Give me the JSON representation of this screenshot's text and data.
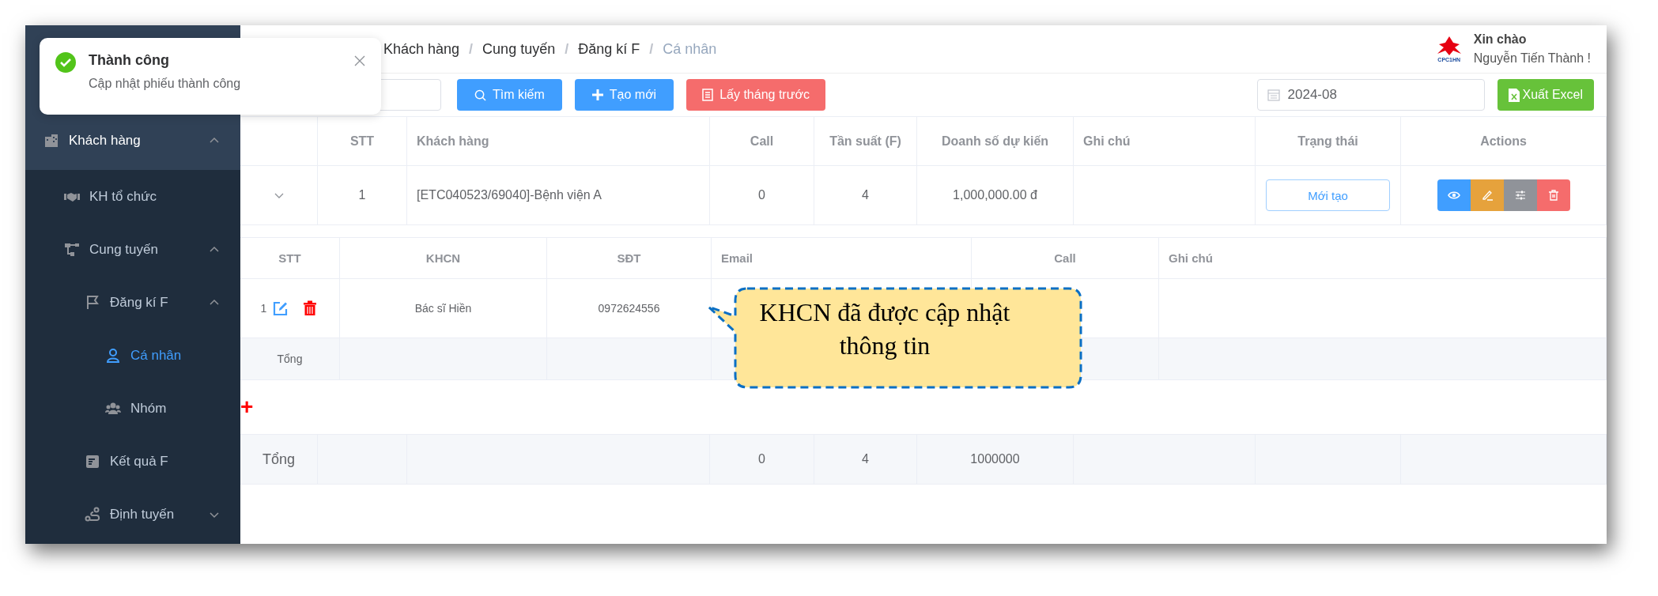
{
  "toast": {
    "title": "Thành công",
    "message": "Cập nhật phiếu thành công"
  },
  "sidebar": {
    "items": [
      {
        "label": "Khách hàng",
        "selected": false,
        "expanded": true,
        "children": [
          {
            "label": "KH tổ chức",
            "selected": false
          },
          {
            "label": "Cung tuyến",
            "selected": false,
            "expanded": true,
            "children": [
              {
                "label": "Đăng kí F",
                "selected": false,
                "expanded": true,
                "children": [
                  {
                    "label": "Cá nhân",
                    "selected": true
                  },
                  {
                    "label": "Nhóm",
                    "selected": false
                  }
                ]
              },
              {
                "label": "Kết quả F",
                "selected": false
              },
              {
                "label": "Định tuyến",
                "selected": false,
                "expanded": false
              }
            ]
          }
        ]
      }
    ]
  },
  "breadcrumb": [
    {
      "label": "Khách hàng"
    },
    {
      "separator": "/",
      "label": "Cung tuyến"
    },
    {
      "separator": "/",
      "label": "Đăng kí F"
    },
    {
      "separator": "/",
      "label": "Cá nhân"
    }
  ],
  "user": {
    "logo_text": "CPC1HN",
    "greeting": "Xin chào",
    "name": "Nguyễn Tiến Thành !"
  },
  "toolbar": {
    "buttons": [
      {
        "label": "Tìm kiếm",
        "kind": "search"
      },
      {
        "label": "Tạo mới",
        "kind": "create"
      },
      {
        "label": "Lấy tháng trước",
        "kind": "previous"
      }
    ],
    "month_field": {
      "value": "2024-08"
    },
    "export_button": "Xuất Excel"
  },
  "table": {
    "columns": [
      "STT",
      "Khách hàng",
      "Call",
      "Tần suất (F)",
      "Doanh số dự kiến",
      "Ghi chú",
      "Trạng thái",
      "Actions"
    ],
    "rows": [
      {
        "expanded": true,
        "stt": "1",
        "customer": "[ETC040523/69040]-Bệnh viện A",
        "call": "0",
        "frequency": "4",
        "revenue": "1,000,000.00 đ",
        "status": "Mới tạo"
      }
    ]
  },
  "detail_table": {
    "columns": [
      "STT",
      "KHCN",
      "SĐT",
      "Email",
      "Call",
      "Ghi chú"
    ],
    "rows": [
      {
        "stt": "1",
        "khcn": "Bác sĩ Hiền",
        "phone": "0972624556"
      }
    ],
    "total_label": "Tổng",
    "add_symbol": "+"
  },
  "footer": {
    "label": "Tổng",
    "call": "0",
    "frequency": "4",
    "revenue": "1000000"
  },
  "callout": {
    "text": "KHCN đã được cập nhật thông tin"
  }
}
